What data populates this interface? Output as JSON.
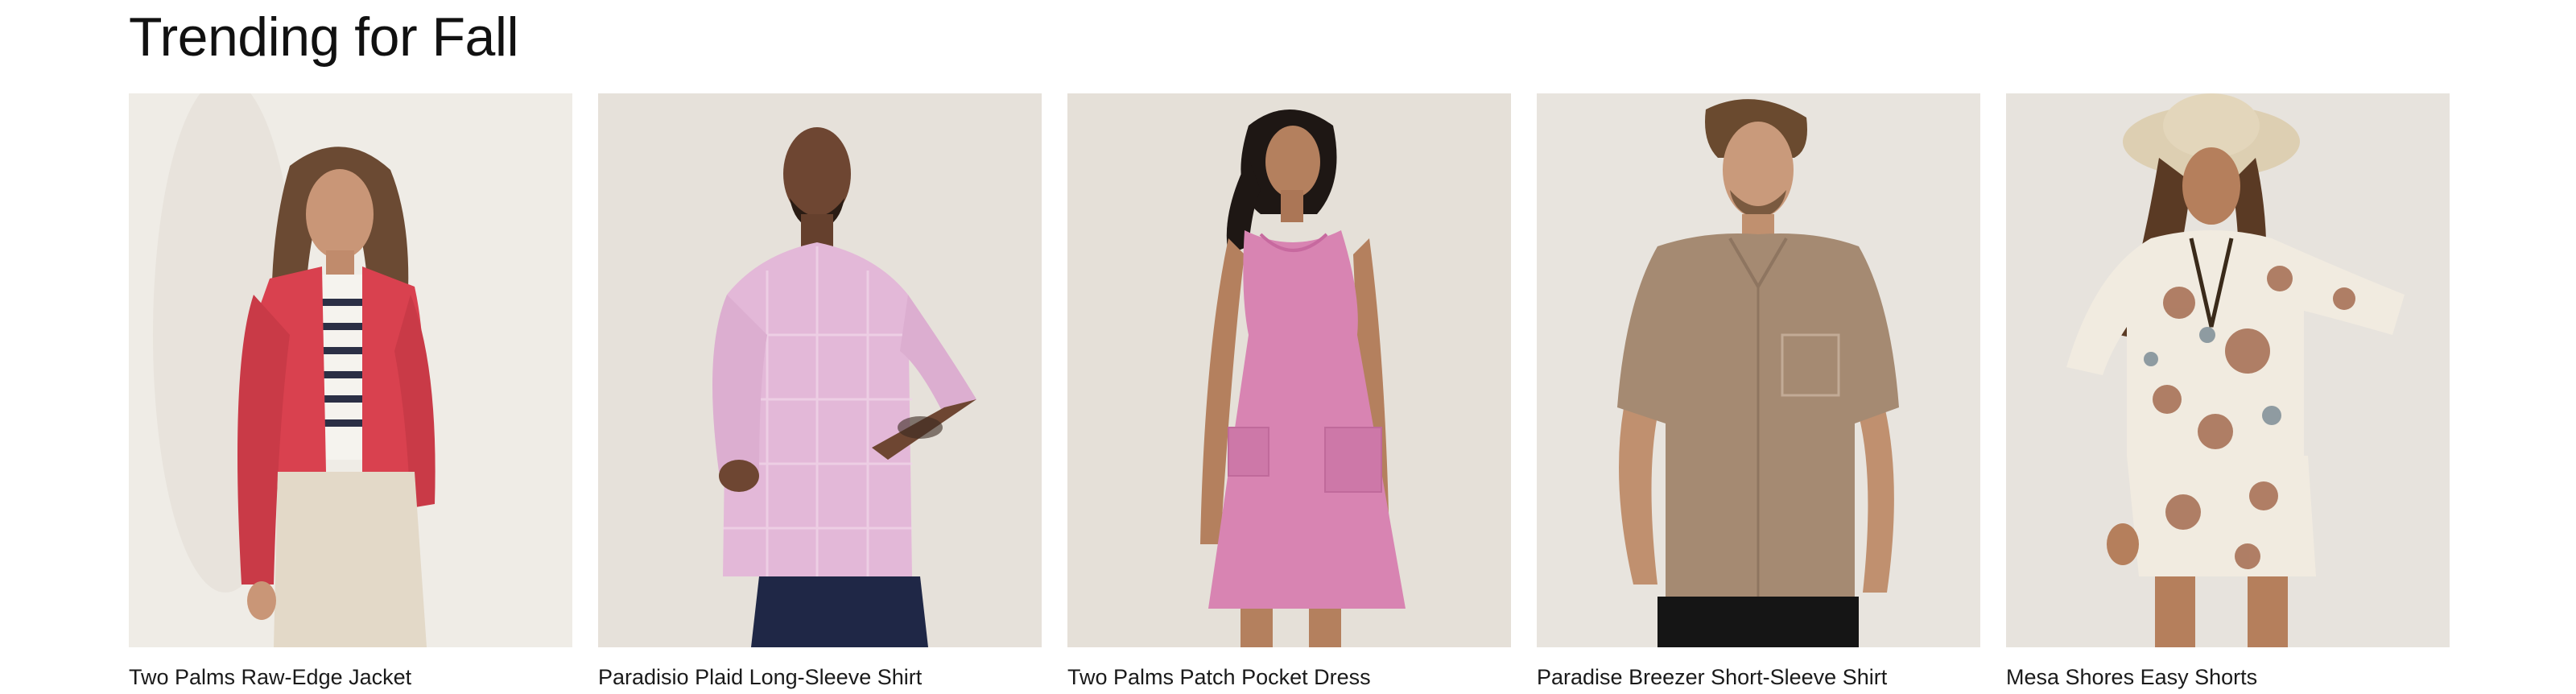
{
  "section": {
    "title": "Trending for Fall"
  },
  "products": [
    {
      "name": "Two Palms Raw-Edge Jacket",
      "garment_color": "#d9414f",
      "backdrop": "#efece6",
      "icon": "product-photo-jacket"
    },
    {
      "name": "Paradisio Plaid Long-Sleeve Shirt",
      "garment_color": "#e3b8d8",
      "backdrop": "#e6e1da",
      "icon": "product-photo-shirt"
    },
    {
      "name": "Two Palms Patch Pocket Dress",
      "garment_color": "#d884b2",
      "backdrop": "#e5e0d8",
      "icon": "product-photo-dress"
    },
    {
      "name": "Paradise Breezer Short-Sleeve Shirt",
      "garment_color": "#a58a72",
      "backdrop": "#e8e4de",
      "icon": "product-photo-shirt"
    },
    {
      "name": "Mesa Shores Easy Shorts",
      "garment_color": "#e9dcc8",
      "backdrop": "#e7e3dd",
      "icon": "product-photo-shorts"
    }
  ]
}
